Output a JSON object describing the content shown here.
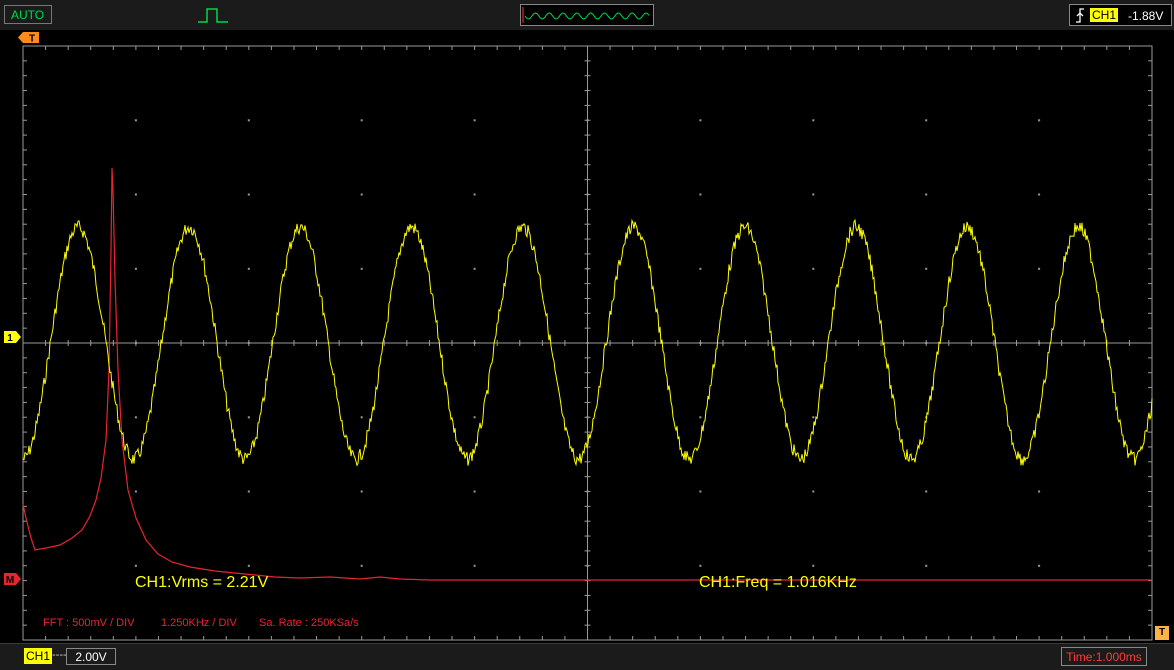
{
  "topbar": {
    "mode": "AUTO",
    "trigger_icon": "pulse-trigger-icon",
    "mini_waveform_icon": "waveform-overview-icon",
    "trigger": {
      "edge_icon": "rising-edge-icon",
      "channel": "CH1",
      "level": "-1.88V"
    }
  },
  "screen": {
    "markers": {
      "trigger": "T",
      "channel": "1",
      "math": "M",
      "trigger_pos": "T"
    },
    "measurements": {
      "vrms": "CH1:Vrms = 2.21V",
      "freq": "CH1:Freq = 1.016KHz"
    },
    "fft_info": {
      "scale": "FFT : 500mV / DIV",
      "freq_div": "1.250KHz / DIV",
      "sample_rate": "Sa. Rate : 250KSa/s"
    }
  },
  "bottombar": {
    "channel": "CH1",
    "coupling": "----",
    "volts_div": "2.00V",
    "time_div": "Time:1.000ms"
  },
  "colors": {
    "ch1": "#ffff00",
    "math": "#e8242e",
    "grid": "#9a9a9a",
    "trigger_marker": "#ff8c1a",
    "mode_text": "#00d84a"
  },
  "chart_data": {
    "type": "line",
    "series": [
      {
        "name": "CH1",
        "kind": "sine",
        "frequency_hz": 1016,
        "vrms": 2.21,
        "cycles_visible": 10.16
      },
      {
        "name": "FFT",
        "kind": "spectrum",
        "peak_frequency_hz": 1016
      }
    ],
    "grid": {
      "x_divisions": 10,
      "y_divisions": 8
    },
    "x_scale": "1.000ms / div",
    "y_scale": "2.00V / div"
  }
}
